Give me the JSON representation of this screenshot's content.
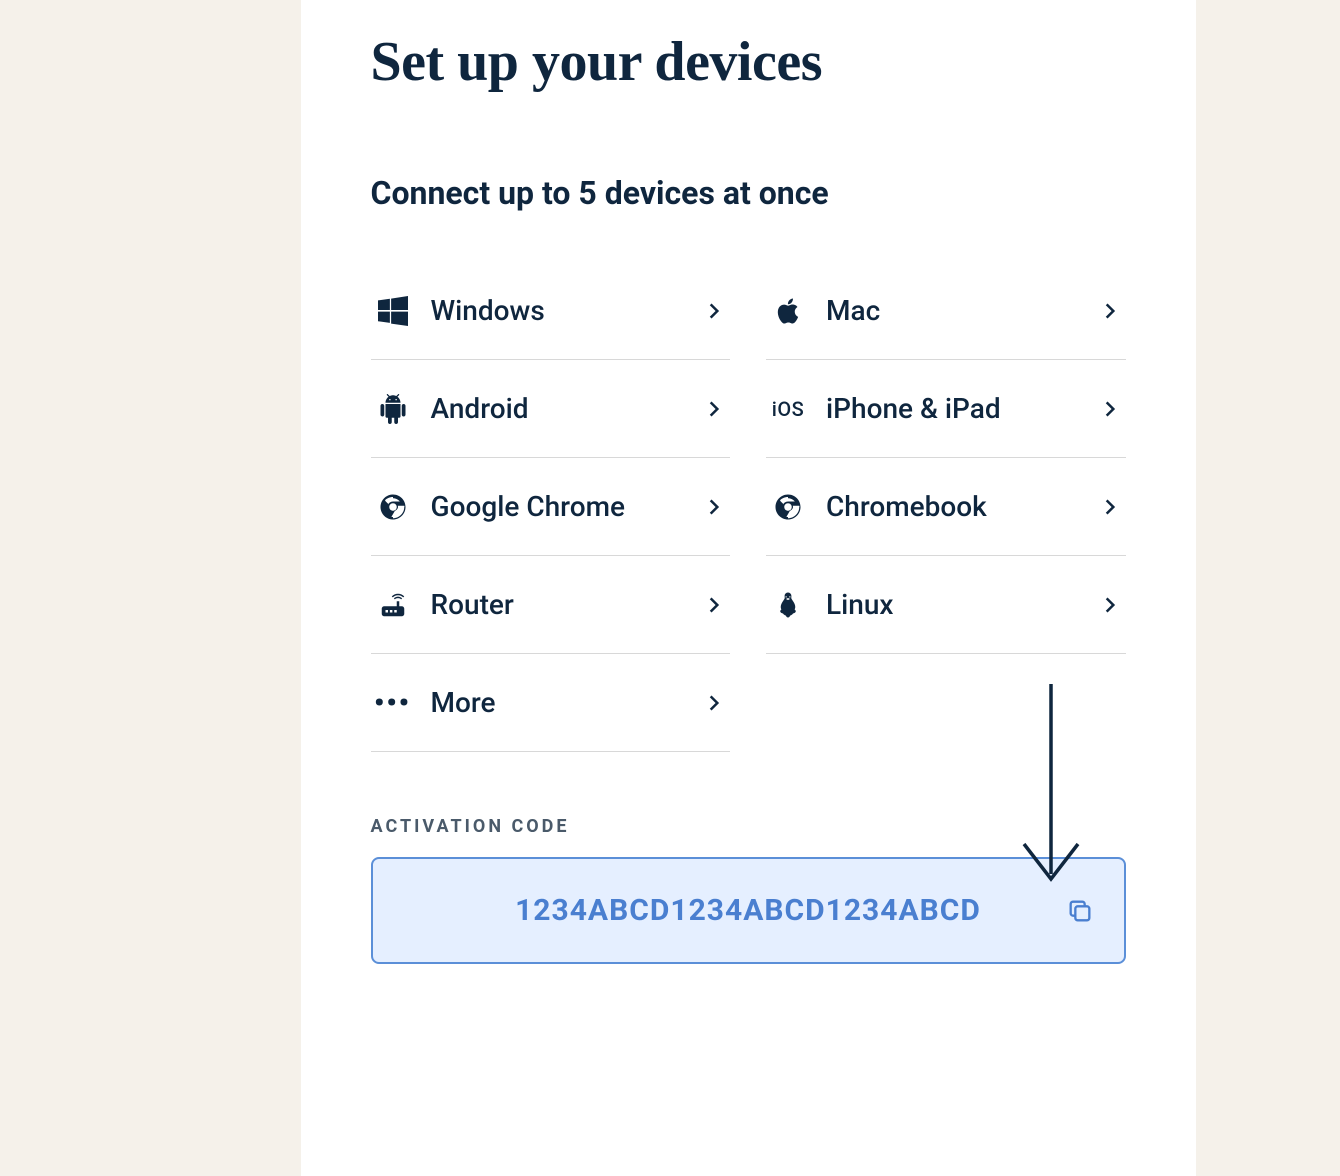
{
  "heading": "Set up your devices",
  "subheading": "Connect up to 5 devices at once",
  "devices": {
    "windows": "Windows",
    "mac": "Mac",
    "android": "Android",
    "ios": "iPhone & iPad",
    "chrome": "Google Chrome",
    "chromebook": "Chromebook",
    "router": "Router",
    "linux": "Linux",
    "more": "More"
  },
  "ios_icon_text": "iOS",
  "activation": {
    "label": "ACTIVATION CODE",
    "code": "1234ABCD1234ABCD1234ABCD"
  }
}
